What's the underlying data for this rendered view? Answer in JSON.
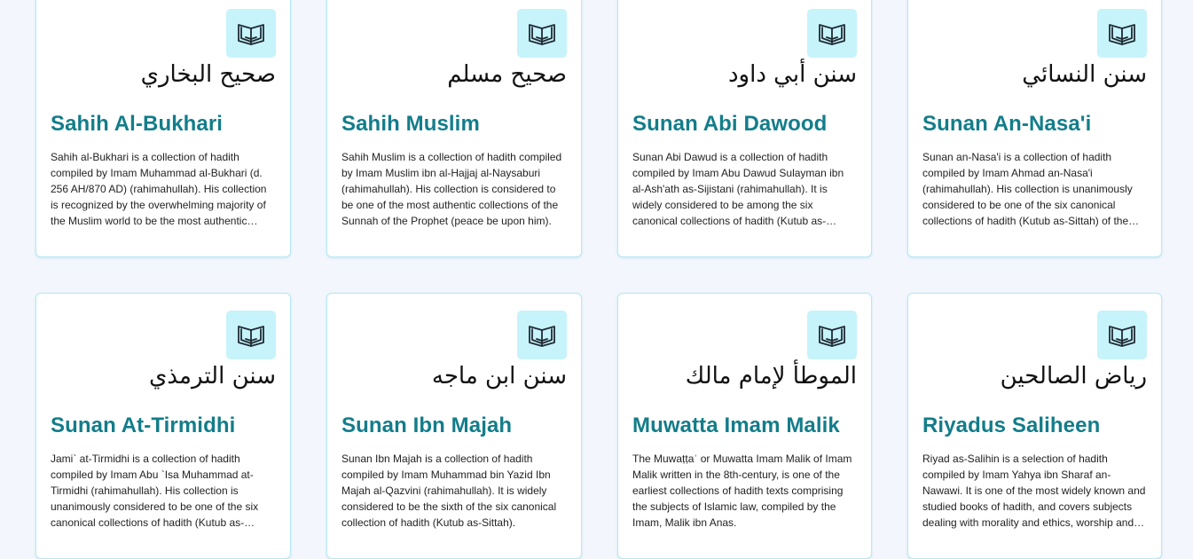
{
  "collections": [
    {
      "arabic": "صحيح البخاري",
      "title": "Sahih Al-Bukhari",
      "description": "Sahih al-Bukhari is a collection of hadith compiled by Imam Muhammad al-Bukhari (d. 256 AH/870 AD) (rahimahullah). His collection is recognized by the overwhelming majority of the Muslim world to be the most authentic collection of reports of the Sunnah of the Prophet."
    },
    {
      "arabic": "صحيح مسلم",
      "title": "Sahih Muslim",
      "description": "Sahih Muslim is a collection of hadith compiled by Imam Muslim ibn al-Hajjaj al-Naysaburi (rahimahullah). His collection is considered to be one of the most authentic collections of the Sunnah of the Prophet (peace be upon him)."
    },
    {
      "arabic": "سنن أبي داود",
      "title": "Sunan Abi Dawood",
      "description": "Sunan Abi Dawud is a collection of hadith compiled by Imam Abu Dawud Sulayman ibn al-Ash'ath as-Sijistani (rahimahullah). It is widely considered to be among the six canonical collections of hadith (Kutub as-Sittah)."
    },
    {
      "arabic": "سنن النسائي",
      "title": "Sunan An-Nasa'i",
      "description": "Sunan an-Nasa'i is a collection of hadith compiled by Imam Ahmad an-Nasa'i (rahimahullah). His collection is unanimously considered to be one of the six canonical collections of hadith (Kutub as-Sittah) of the Sunnah of the Prophet."
    },
    {
      "arabic": "سنن الترمذي",
      "title": "Sunan At-Tirmidhi",
      "description": "Jami` at-Tirmidhi is a collection of hadith compiled by Imam Abu `Isa Muhammad at-Tirmidhi (rahimahullah). His collection is unanimously considered to be one of the six canonical collections of hadith (Kutub as-Sittah)."
    },
    {
      "arabic": "سنن ابن ماجه",
      "title": "Sunan Ibn Majah",
      "description": "Sunan Ibn Majah is a collection of hadith compiled by Imam Muhammad bin Yazid Ibn Majah al-Qazvini (rahimahullah). It is widely considered to be the sixth of the six canonical collection of hadith (Kutub as-Sittah)."
    },
    {
      "arabic": "الموطأ لإمام مالك",
      "title": "Muwatta Imam Malik",
      "description": "The Muwaṭṭaʾ or Muwatta Imam Malik of Imam Malik written in the 8th-century, is one of the earliest collections of hadith texts comprising the subjects of Islamic law, compiled by the Imam, Malik ibn Anas."
    },
    {
      "arabic": "رياض الصالحين",
      "title": "Riyadus Saliheen",
      "description": "Riyad as-Salihin is a selection of hadith compiled by Imam Yahya ibn Sharaf an-Nawawi. It is one of the most widely known and studied books of hadith, and covers subjects dealing with morality and ethics, worship and manners."
    }
  ],
  "icon": "open-book-icon",
  "colors": {
    "page_background": "#f3f7fd",
    "card_border": "#b6e8f3",
    "icon_background": "#c7f3fb",
    "title": "#137d8a",
    "text": "#222222"
  }
}
